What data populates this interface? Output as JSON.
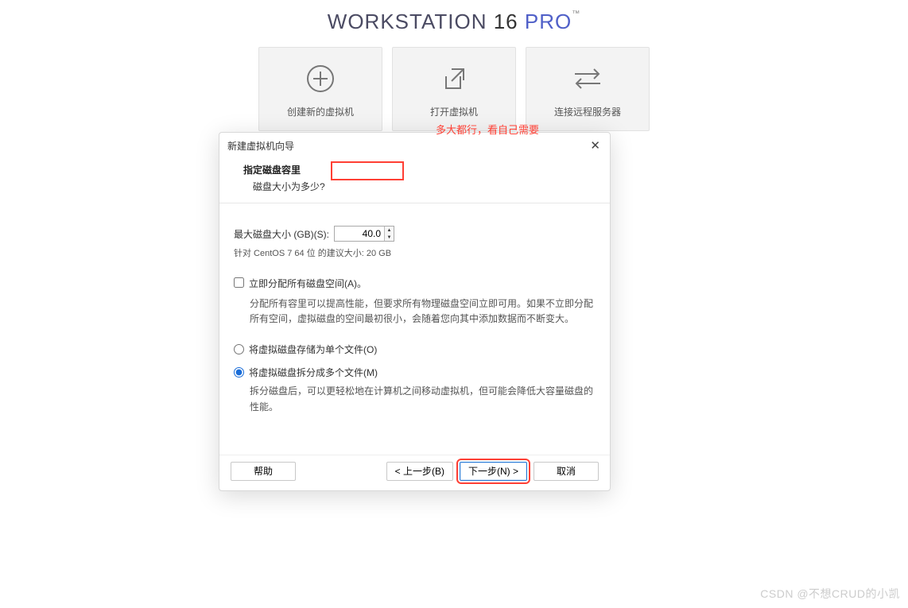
{
  "brand": {
    "workstation": "WORKSTATION",
    "version": "16",
    "pro": "PRO",
    "tm": "™"
  },
  "tiles": {
    "create": "创建新的虚拟机",
    "open": "打开虚拟机",
    "connect": "连接远程服务器"
  },
  "dialog": {
    "title": "新建虚拟机向导",
    "heading": "指定磁盘容里",
    "subheading": "磁盘大小为多少?",
    "max_label": "最大磁盘大小 (GB)(S):",
    "max_value": "40.0",
    "recommend": "针对 CentOS 7 64 位 的建议大小: 20 GB",
    "alloc_now": "立即分配所有磁盘空间(A)。",
    "alloc_desc": "分配所有容里可以提高性能，但要求所有物理磁盘空间立即可用。如果不立即分配所有空间，虚拟磁盘的空间最初很小，会随着您向其中添加数据而不断变大。",
    "radio_single": "将虚拟磁盘存储为单个文件(O)",
    "radio_split": "将虚拟磁盘拆分成多个文件(M)",
    "split_desc": "拆分磁盘后，可以更轻松地在计算机之间移动虚拟机，但可能会降低大容量磁盘的性能。",
    "help": "帮助",
    "back": "< 上一步(B)",
    "next": "下一步(N) >",
    "cancel": "取消"
  },
  "annotation": "多大都行，看自己需要",
  "watermark": "CSDN @不想CRUD的小凯"
}
